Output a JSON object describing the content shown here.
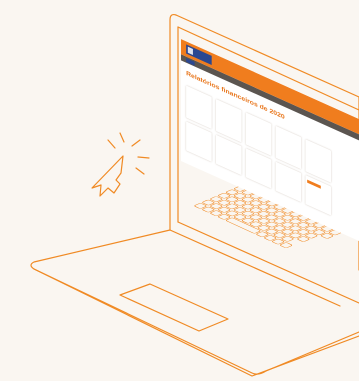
{
  "app": {
    "logo_text": "",
    "nav_items": [
      "",
      "",
      "",
      ""
    ],
    "breadcrumb": "",
    "page_title": "Relatórios financeiros de 2020",
    "tabs": [
      "",
      "",
      "",
      ""
    ]
  },
  "cards": [
    {
      "label": "",
      "value": "",
      "note": "",
      "button": ""
    },
    {
      "label": "",
      "value": "",
      "note": "",
      "button": ""
    },
    {
      "label": "",
      "value": "",
      "note": "",
      "button": ""
    },
    {
      "label": "",
      "value": "",
      "note": "",
      "button": ""
    },
    {
      "label": "",
      "value": "",
      "note": "",
      "button": ""
    },
    {
      "label": "",
      "value": "",
      "note": "",
      "button": ""
    },
    {
      "label": "",
      "value": "",
      "note": "",
      "button": ""
    },
    {
      "label": "",
      "value": "",
      "note": "",
      "button": ""
    },
    {
      "label": "",
      "value": "",
      "note": "",
      "button": ""
    },
    {
      "label": "",
      "value": "",
      "note": "",
      "button": ""
    }
  ],
  "colors": {
    "background": "#faf6f1",
    "accent_orange": "#f07d1e",
    "brand_blue": "#2b4791",
    "nav_gray": "#5b5550",
    "line_orange": "#f08a24"
  },
  "icons": [
    "laptop-icon",
    "cursor-click-icon"
  ]
}
